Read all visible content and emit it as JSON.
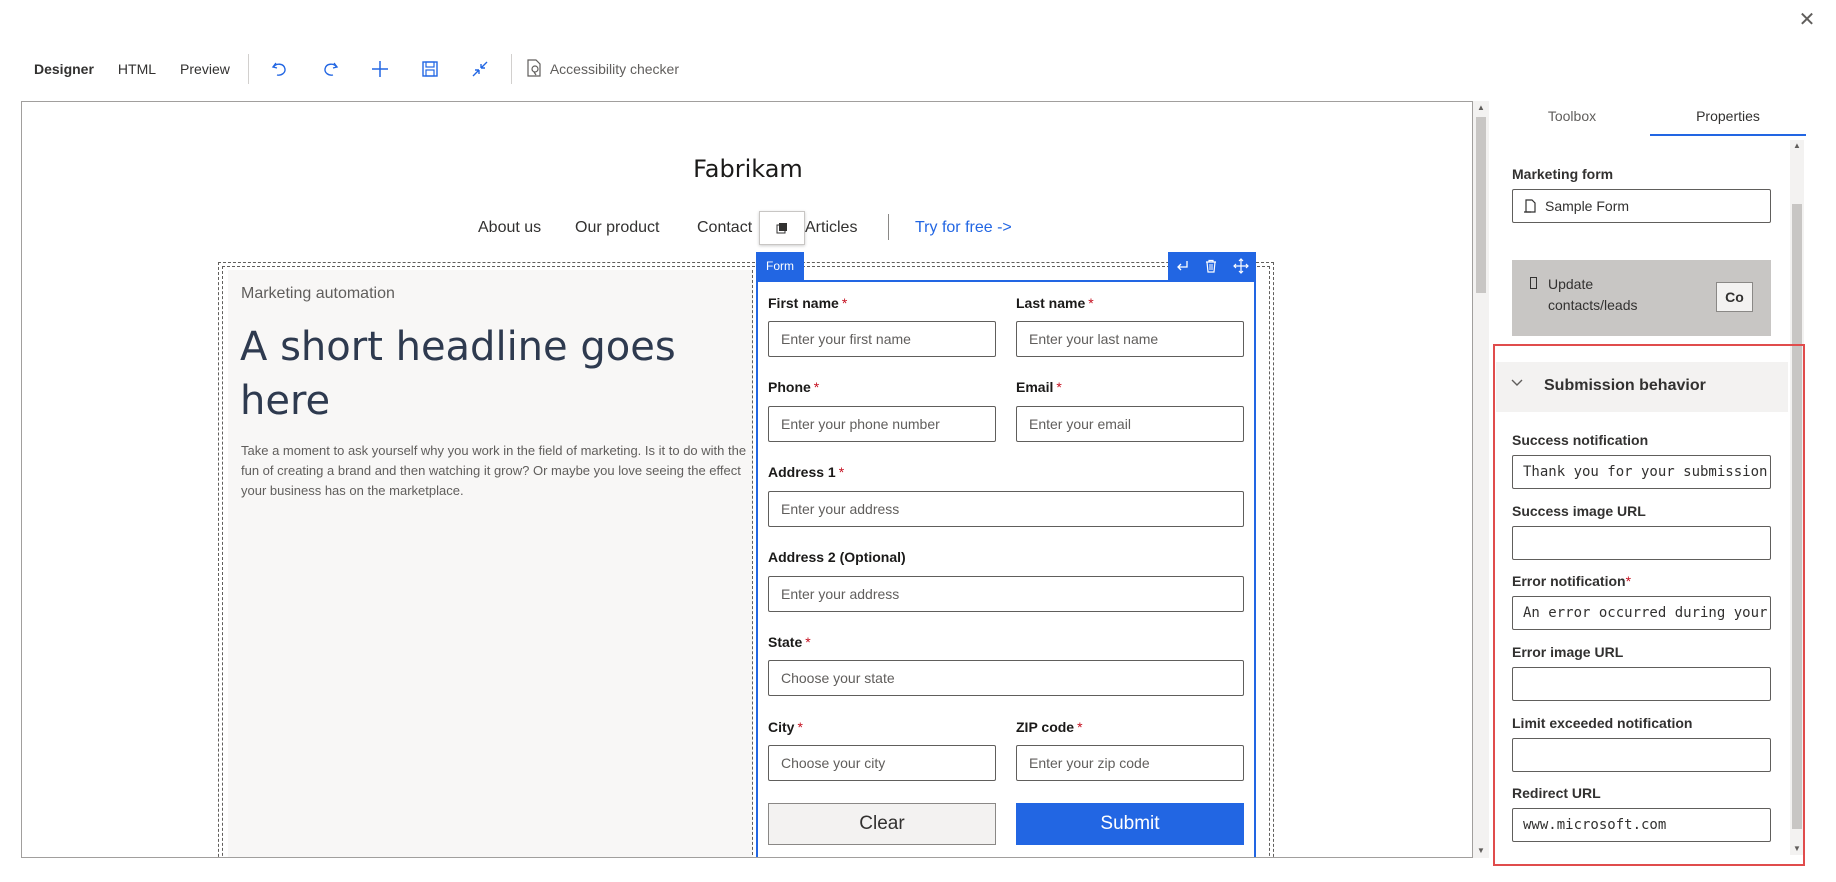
{
  "toolbar": {
    "tabs": [
      "Designer",
      "HTML",
      "Preview"
    ],
    "accessibility_label": "Accessibility checker"
  },
  "page": {
    "brand": "Fabrikam",
    "nav": [
      "About us",
      "Our product",
      "Contact",
      "Articles"
    ],
    "nav_cta": "Try for free ->",
    "eyebrow": "Marketing automation",
    "headline": "A short headline goes here",
    "body": "Take a moment to ask yourself why you work in the field of marketing. Is it to do with the fun of creating a brand and then watching it grow? Or maybe you love seeing the effect your business has on the marketplace."
  },
  "form": {
    "tag": "Form",
    "fields": {
      "first_name": {
        "label": "First name",
        "placeholder": "Enter your first name"
      },
      "last_name": {
        "label": "Last name",
        "placeholder": "Enter your last name"
      },
      "phone": {
        "label": "Phone",
        "placeholder": "Enter your phone number"
      },
      "email": {
        "label": "Email",
        "placeholder": "Enter your email"
      },
      "address1": {
        "label": "Address 1",
        "placeholder": "Enter your address"
      },
      "address2": {
        "label": "Address 2 (Optional)",
        "placeholder": "Enter your address"
      },
      "state": {
        "label": "State",
        "placeholder": "Choose your state"
      },
      "city": {
        "label": "City",
        "placeholder": "Choose your city"
      },
      "zip": {
        "label": "ZIP code",
        "placeholder": "Enter your zip code"
      }
    },
    "required_mark": "*",
    "clear_label": "Clear",
    "submit_label": "Submit"
  },
  "pane": {
    "tabs": [
      "Toolbox",
      "Properties"
    ],
    "marketing_form_label": "Marketing form",
    "marketing_form_value": "Sample Form",
    "update_text_line1": "Update",
    "update_text_line2": "contacts/leads",
    "co_button": "Co",
    "submission_title": "Submission behavior",
    "success_notification_label": "Success notification",
    "success_notification_value": "Thank you for your submission.",
    "success_image_label": "Success image URL",
    "success_image_value": "",
    "error_notification_label": "Error notification",
    "error_notification_value": "An error occurred during your su",
    "error_image_label": "Error image URL",
    "error_image_value": "",
    "limit_label": "Limit exceeded notification",
    "limit_value": "",
    "redirect_label": "Redirect URL",
    "redirect_value": "www.microsoft.com"
  },
  "colors": {
    "accent": "#2266e3",
    "highlight": "#e04c4c",
    "required": "#c50f1f"
  },
  "icons": [
    "close-icon",
    "undo-icon",
    "redo-icon",
    "add-icon",
    "save-icon",
    "collapse-icon",
    "accessibility-icon",
    "select-parent-icon",
    "delete-icon",
    "move-icon",
    "form-icon",
    "chevron-down-icon"
  ]
}
